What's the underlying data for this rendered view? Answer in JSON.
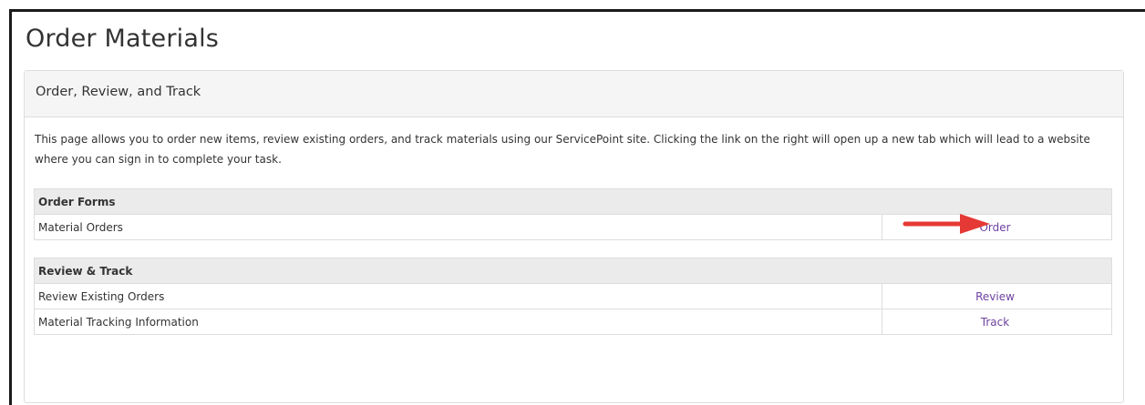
{
  "page": {
    "title": "Order Materials"
  },
  "panel": {
    "heading": "Order, Review, and Track",
    "description": "This page allows you to order new items, review existing orders, and track materials using our ServicePoint site. Clicking the link on the right will open up a new tab which will lead to a website where you can sign in to complete your task."
  },
  "order_forms": {
    "header": "Order Forms",
    "rows": [
      {
        "label": "Material Orders",
        "link": "Order"
      }
    ]
  },
  "review_track": {
    "header": "Review & Track",
    "rows": [
      {
        "label": "Review Existing Orders",
        "link": "Review"
      },
      {
        "label": "Material Tracking Information",
        "link": "Track"
      }
    ]
  },
  "annotation": {
    "arrow_color": "#e53935",
    "icon": "arrow-right-icon"
  },
  "colors": {
    "link": "#6f42a1",
    "header_bg": "#ebebeb",
    "panel_heading_bg": "#f5f5f5",
    "border": "#dddddd"
  }
}
